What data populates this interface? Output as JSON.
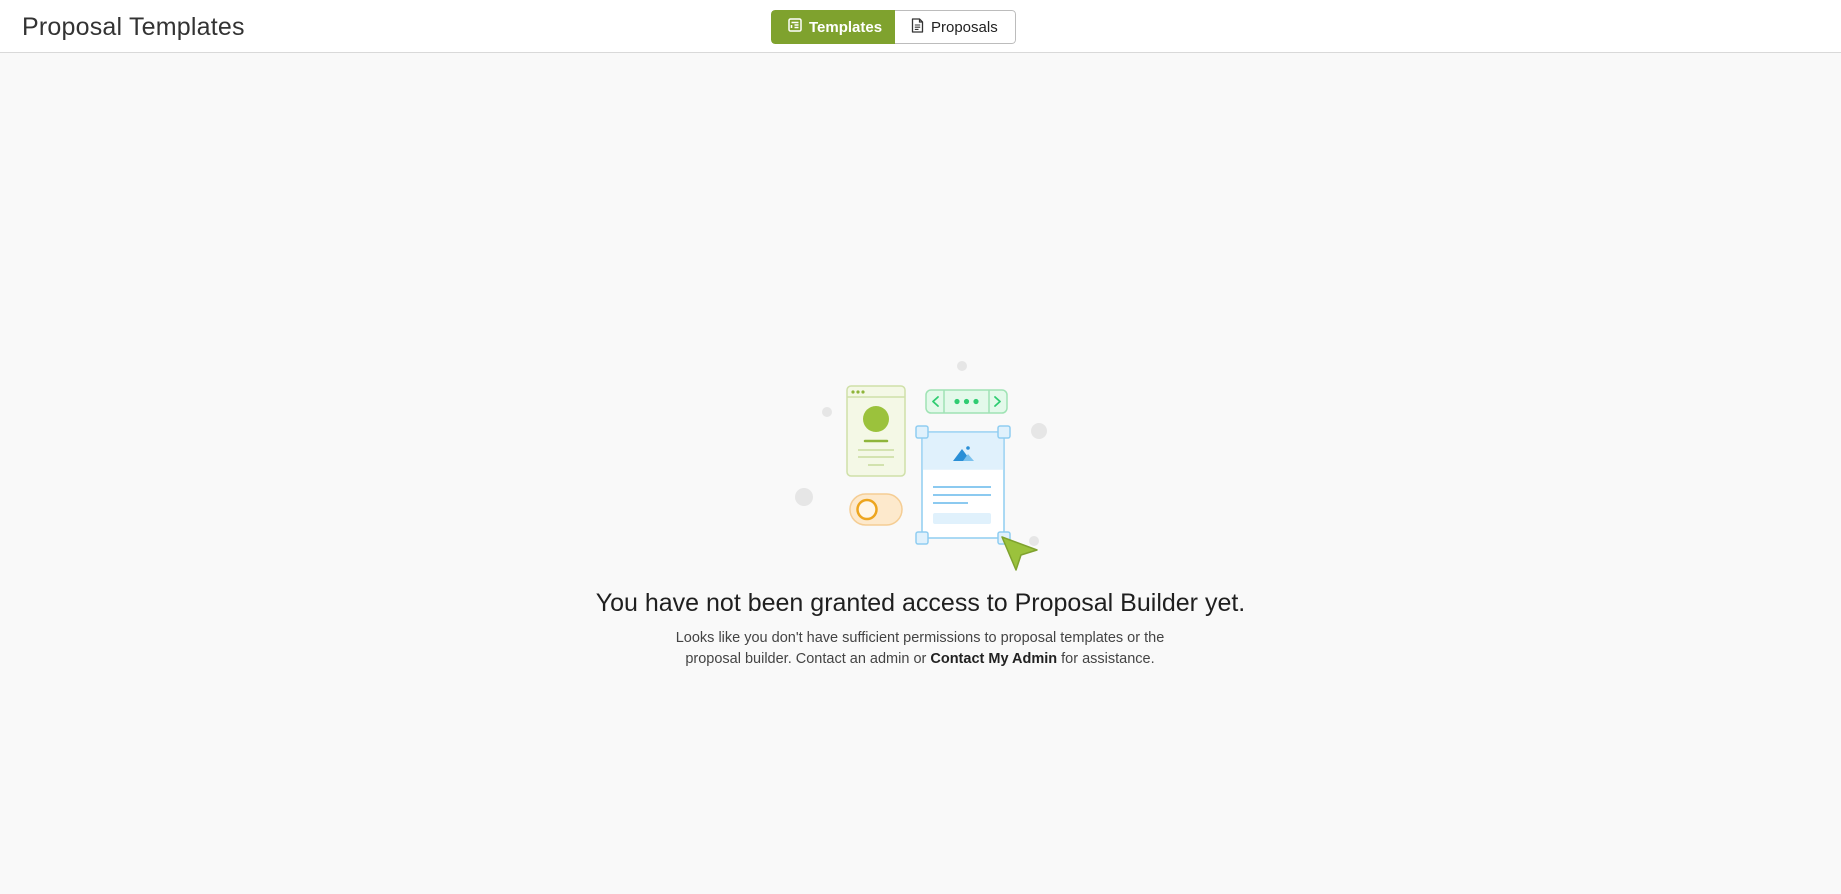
{
  "header": {
    "title": "Proposal Templates",
    "tabs": [
      {
        "label": "Templates",
        "icon": "template-icon",
        "active": true
      },
      {
        "label": "Proposals",
        "icon": "document-icon",
        "active": false
      }
    ]
  },
  "empty_state": {
    "illustration": "proposal-builder-illustration",
    "heading": "You have not been granted access to Proposal Builder yet.",
    "description_before": "Looks like you don't have sufficient permissions to proposal templates or the proposal builder. Contact an admin or",
    "link_label": "Contact My Admin",
    "description_after": "for assistance."
  },
  "colors": {
    "accent": "#7fa22e",
    "background": "#f9f9f9",
    "header_bg": "#ffffff"
  }
}
